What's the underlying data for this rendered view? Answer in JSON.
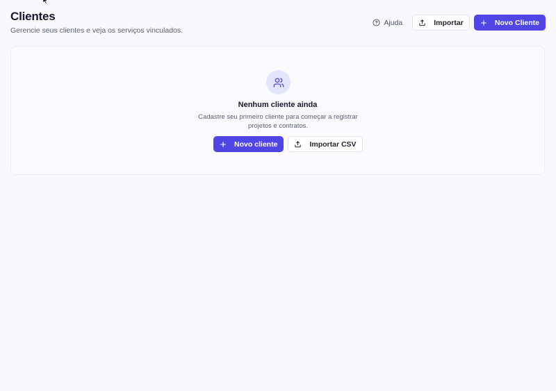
{
  "header": {
    "title": "Clientes",
    "subtitle": "Gerencie seus clientes e veja os serviços vinculados.",
    "help_label": "Ajuda",
    "import_label": "Importar",
    "new_client_label": "Novo Cliente"
  },
  "empty_state": {
    "title": "Nenhum cliente ainda",
    "description": "Cadastre seu primeiro cliente para começar a registrar projetos e contratos.",
    "new_client_label": "Novo cliente",
    "import_csv_label": "Importar CSV"
  },
  "icons": {
    "help": "help-circle-icon",
    "import": "upload-icon",
    "add": "plus-icon",
    "empty": "users-icon",
    "cursor": "mouse-pointer-icon"
  },
  "colors": {
    "accent": "#4f46e5",
    "background": "#f8f8fd",
    "icon_circle": "#e2e5fb",
    "text_primary": "#15172b",
    "text_secondary": "#5b6070"
  }
}
